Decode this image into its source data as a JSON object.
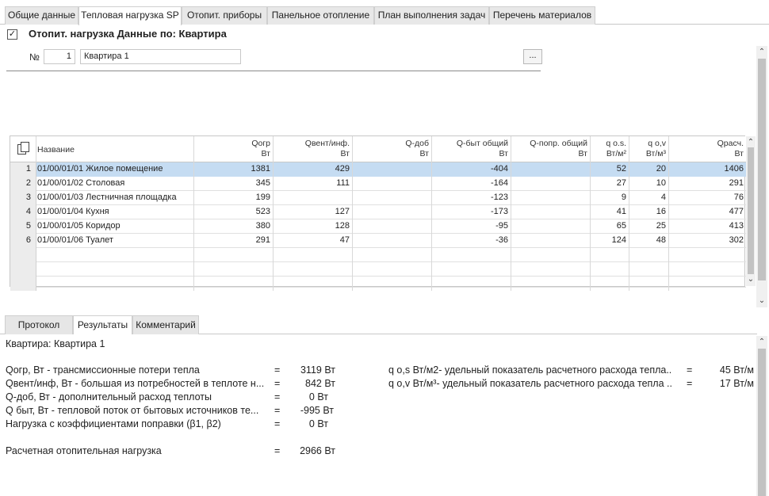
{
  "top_tabs": [
    {
      "label": "Общие данные"
    },
    {
      "label": "Тепловая нагрузка SP"
    },
    {
      "label": "Отопит. приборы"
    },
    {
      "label": "Панельное отопление"
    },
    {
      "label": "План выполнения задач"
    },
    {
      "label": "Перечень материалов"
    }
  ],
  "section": {
    "checked": "✓",
    "title": "Отопит. нагрузка Данные по: Квартира",
    "num_label": "№",
    "num_value": "1",
    "name_value": "Квартира 1",
    "dots_label": "..."
  },
  "grid": {
    "headers": [
      {
        "l1": "Название",
        "l2": ""
      },
      {
        "l1": "Qогр",
        "l2": "Вт"
      },
      {
        "l1": "Qвент/инф.",
        "l2": "Вт"
      },
      {
        "l1": "Q-доб",
        "l2": "Вт"
      },
      {
        "l1": "Q-быт общий",
        "l2": "Вт"
      },
      {
        "l1": "Q-попр. общий",
        "l2": "Вт"
      },
      {
        "l1": "q o.s.",
        "l2": "Вт/м²"
      },
      {
        "l1": "q o,v",
        "l2": "Вт/м³"
      },
      {
        "l1": "Qрасч.",
        "l2": "Вт"
      }
    ],
    "rows": [
      {
        "n": "1",
        "name": "01/00/01/01 Жилое помещение",
        "qogr": "1381",
        "qvent": "429",
        "qdob": "",
        "qbyt": "-404",
        "qpopr": "",
        "qos": "52",
        "qov": "20",
        "qras": "1406"
      },
      {
        "n": "2",
        "name": "01/00/01/02 Столовая",
        "qogr": "345",
        "qvent": "111",
        "qdob": "",
        "qbyt": "-164",
        "qpopr": "",
        "qos": "27",
        "qov": "10",
        "qras": "291"
      },
      {
        "n": "3",
        "name": "01/00/01/03 Лестничная площадка",
        "qogr": "199",
        "qvent": "",
        "qdob": "",
        "qbyt": "-123",
        "qpopr": "",
        "qos": "9",
        "qov": "4",
        "qras": "76"
      },
      {
        "n": "4",
        "name": "01/00/01/04 Кухня",
        "qogr": "523",
        "qvent": "127",
        "qdob": "",
        "qbyt": "-173",
        "qpopr": "",
        "qos": "41",
        "qov": "16",
        "qras": "477"
      },
      {
        "n": "5",
        "name": "01/00/01/05 Коридор",
        "qogr": "380",
        "qvent": "128",
        "qdob": "",
        "qbyt": "-95",
        "qpopr": "",
        "qos": "65",
        "qov": "25",
        "qras": "413"
      },
      {
        "n": "6",
        "name": "01/00/01/06 Туалет",
        "qogr": "291",
        "qvent": "47",
        "qdob": "",
        "qbyt": "-36",
        "qpopr": "",
        "qos": "124",
        "qov": "48",
        "qras": "302"
      }
    ],
    "selected_row": "1"
  },
  "bottom_tabs": [
    {
      "label": "Протокол"
    },
    {
      "label": "Результаты"
    },
    {
      "label": "Комментарий"
    }
  ],
  "results": {
    "heading": "Квартира: Квартира 1",
    "left": [
      {
        "label": "Qогр, Вт - трансмиссионные потери тепла",
        "eq": "=",
        "value": "3119 Вт"
      },
      {
        "label": "Qвент/инф, Вт - большая из потребностей в теплоте н...",
        "eq": "=",
        "value": "842 Вт"
      },
      {
        "label": "Q-доб, Вт - дополнительный расход теплоты",
        "eq": "=",
        "value": "0 Вт"
      },
      {
        "label": "Q быт, Вт - тепловой поток от бытовых источников те...",
        "eq": "=",
        "value": "-995 Вт"
      },
      {
        "label": "Нагрузка с коэффициентами поправки (β1, β2)",
        "eq": "=",
        "value": "0 Вт"
      }
    ],
    "total": {
      "label": "Расчетная отопительная нагрузка",
      "eq": "=",
      "value": "2966 Вт"
    },
    "right": [
      {
        "label": "q o,s Вт/м2- удельный показатель расчетного расхода тепла..",
        "eq": "=",
        "value": "45 Вт/м"
      },
      {
        "label": "q o,v Вт/м³- удельный показатель расчетного расхода тепла ..",
        "eq": "=",
        "value": "17 Вт/м"
      }
    ]
  },
  "icons": {
    "copy": "copy-rows-icon",
    "scroll_up": "scroll-up-arrow-icon",
    "scroll_down": "scroll-down-arrow-icon"
  },
  "colors": {
    "selected_row": "#c5dcf2",
    "tab_bg": "#e8e8e8",
    "active_tab_bg": "#ffffff"
  }
}
